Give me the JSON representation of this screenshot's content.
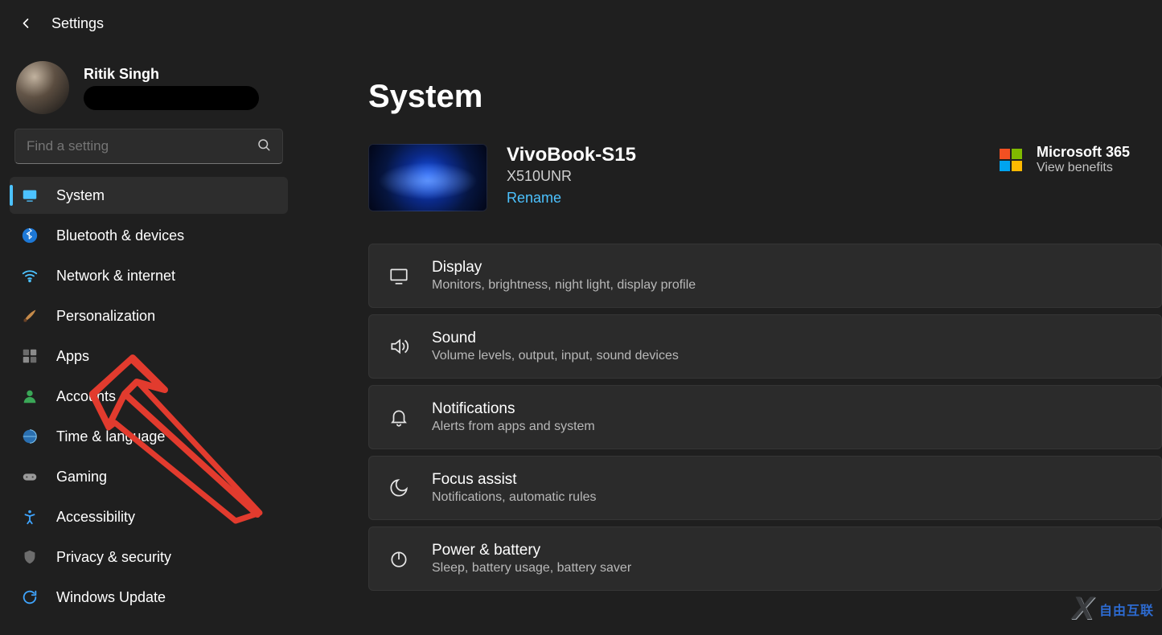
{
  "header": {
    "title": "Settings"
  },
  "profile": {
    "name": "Ritik Singh"
  },
  "search": {
    "placeholder": "Find a setting"
  },
  "sidebar": {
    "items": [
      {
        "label": "System"
      },
      {
        "label": "Bluetooth & devices"
      },
      {
        "label": "Network & internet"
      },
      {
        "label": "Personalization"
      },
      {
        "label": "Apps"
      },
      {
        "label": "Accounts"
      },
      {
        "label": "Time & language"
      },
      {
        "label": "Gaming"
      },
      {
        "label": "Accessibility"
      },
      {
        "label": "Privacy & security"
      },
      {
        "label": "Windows Update"
      }
    ]
  },
  "page": {
    "title": "System"
  },
  "device": {
    "name": "VivoBook-S15",
    "model": "X510UNR",
    "rename_label": "Rename"
  },
  "microsoft": {
    "title": "Microsoft 365",
    "subtitle": "View benefits"
  },
  "cards": [
    {
      "title": "Display",
      "subtitle": "Monitors, brightness, night light, display profile"
    },
    {
      "title": "Sound",
      "subtitle": "Volume levels, output, input, sound devices"
    },
    {
      "title": "Notifications",
      "subtitle": "Alerts from apps and system"
    },
    {
      "title": "Focus assist",
      "subtitle": "Notifications, automatic rules"
    },
    {
      "title": "Power & battery",
      "subtitle": "Sleep, battery usage, battery saver"
    }
  ],
  "watermark": {
    "text": "自由互联"
  }
}
